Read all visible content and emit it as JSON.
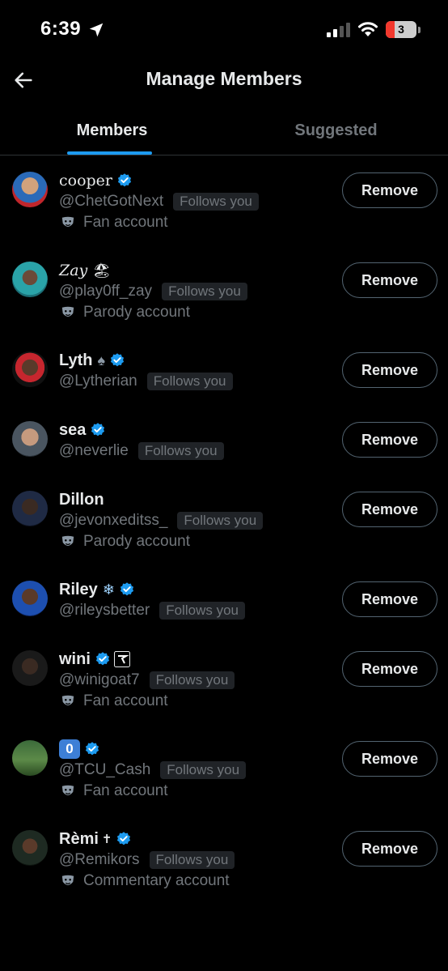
{
  "status_bar": {
    "time": "6:39",
    "battery": "3"
  },
  "header": {
    "title": "Manage Members"
  },
  "tabs": [
    {
      "label": "Members",
      "active": true
    },
    {
      "label": "Suggested",
      "active": false
    }
  ],
  "members": [
    {
      "name": "cooper",
      "emoji": "",
      "verified": true,
      "handle": "@ChetGotNext",
      "follows": "Follows you",
      "account_label": "Fan account",
      "remove_label": "Remove"
    },
    {
      "name": "Zay",
      "emoji": "🏖",
      "verified": false,
      "handle": "@play0ff_zay",
      "follows": "Follows you",
      "account_label": "Parody account",
      "remove_label": "Remove"
    },
    {
      "name": "Lyth",
      "emoji": "♠",
      "verified": true,
      "handle": "@Lytherian",
      "follows": "Follows you",
      "account_label": "",
      "remove_label": "Remove"
    },
    {
      "name": "sea",
      "emoji": "",
      "verified": true,
      "handle": "@neverlie",
      "follows": "Follows you",
      "account_label": "",
      "remove_label": "Remove"
    },
    {
      "name": "Dillon",
      "emoji": "",
      "verified": false,
      "handle": "@jevonxeditss_",
      "follows": "Follows you",
      "account_label": "Parody account",
      "remove_label": "Remove"
    },
    {
      "name": "Riley",
      "emoji": "❄",
      "verified": true,
      "handle": "@rileysbetter",
      "follows": "Follows you",
      "account_label": "",
      "remove_label": "Remove"
    },
    {
      "name": "wini",
      "emoji": "",
      "verified": true,
      "handle": "@winigoat7",
      "follows": "Follows you",
      "account_label": "Fan account",
      "remove_label": "Remove"
    },
    {
      "name": "0",
      "emoji": "",
      "verified": true,
      "handle": "@TCU_Cash",
      "follows": "Follows you",
      "account_label": "Fan account",
      "remove_label": "Remove"
    },
    {
      "name": "Rèmi",
      "emoji": "✝",
      "verified": true,
      "handle": "@Remikors",
      "follows": "Follows you",
      "account_label": "Commentary account",
      "remove_label": "Remove"
    }
  ],
  "colors": {
    "accent": "#1d9bf0",
    "background": "#000000",
    "muted": "#71767b",
    "text": "#e7e9ea"
  }
}
